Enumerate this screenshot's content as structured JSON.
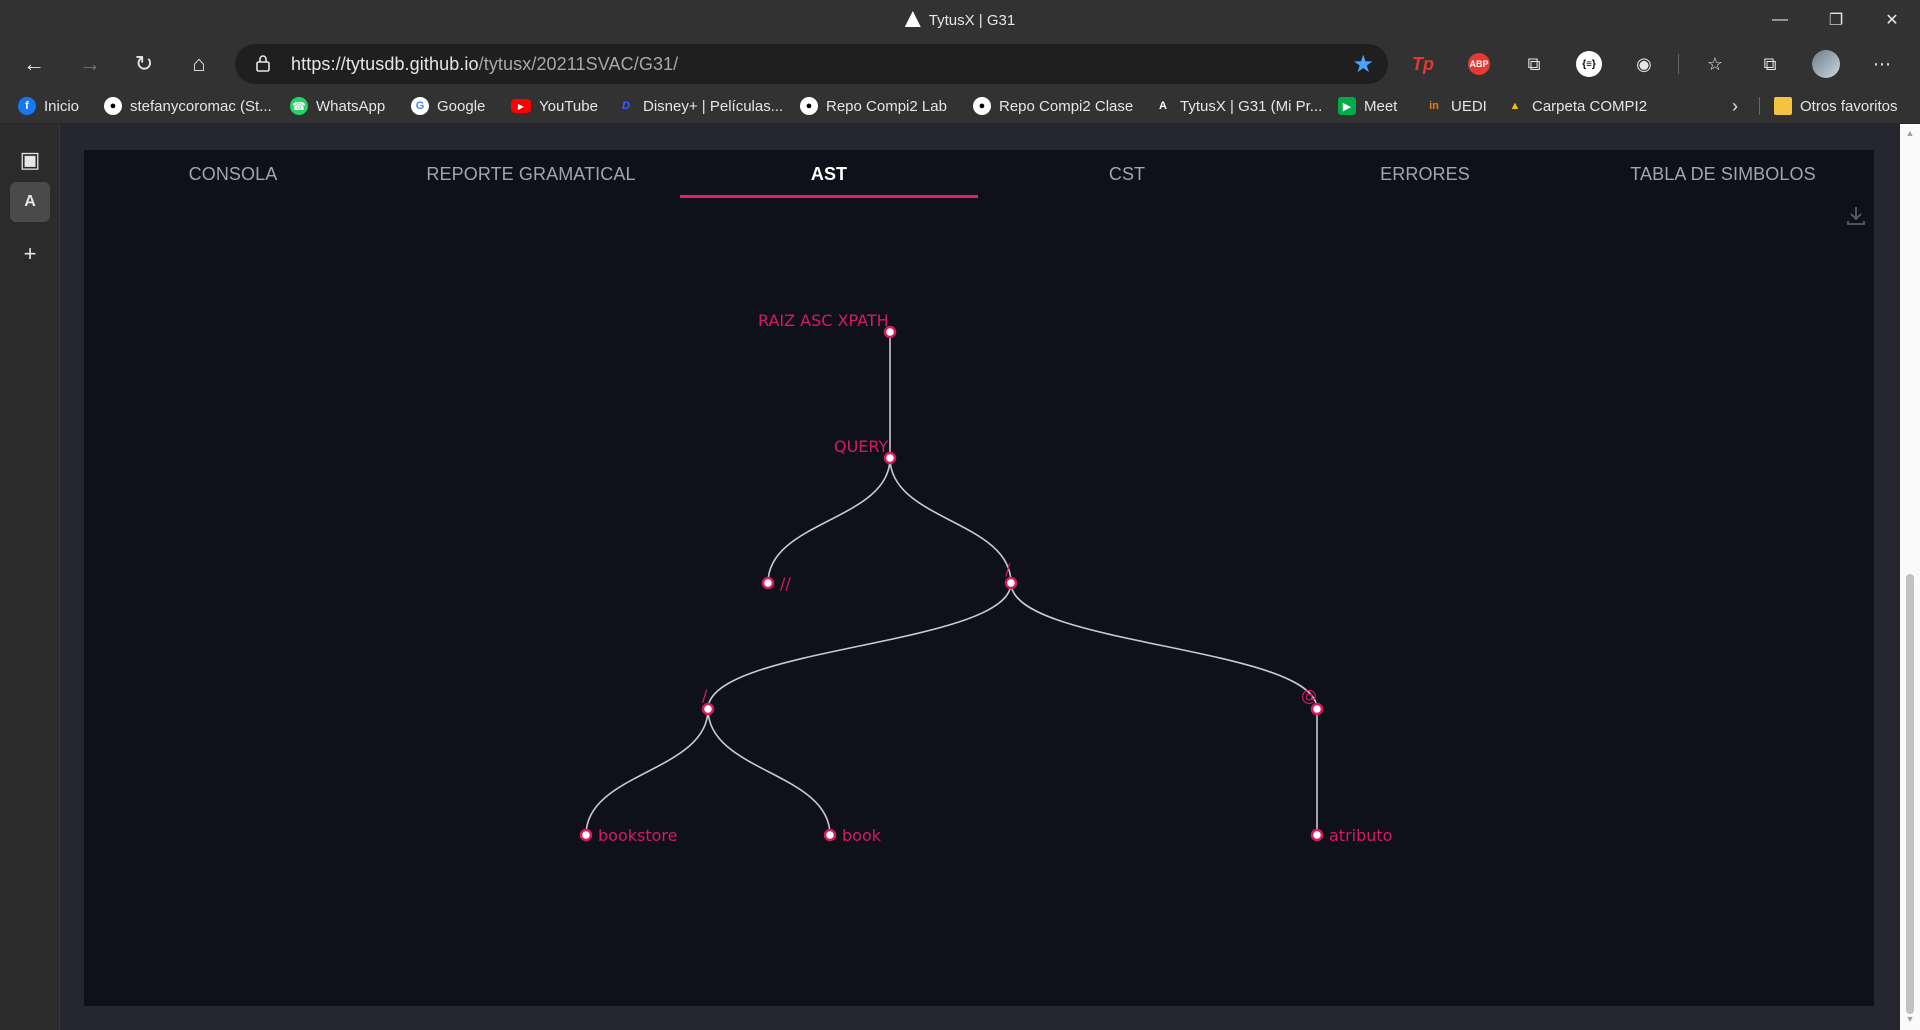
{
  "window": {
    "title": "TytusX | G31"
  },
  "address_bar": {
    "url_host": "https://tytusdb.github.io",
    "url_path": "/tytusx/20211SVAC/G31/"
  },
  "extensions": [
    "Tp",
    "ABP",
    "{≡}"
  ],
  "bookmarks": [
    {
      "label": "Inicio",
      "icon": "facebook-icon",
      "color": "#1877f2"
    },
    {
      "label": "stefanycoromac (St...",
      "icon": "github-icon",
      "color": "#ffffff"
    },
    {
      "label": "WhatsApp",
      "icon": "whatsapp-icon",
      "color": "#25d366"
    },
    {
      "label": "Google",
      "icon": "google-icon",
      "color": "#ffffff"
    },
    {
      "label": "YouTube",
      "icon": "youtube-icon",
      "color": "#ff0000"
    },
    {
      "label": "Disney+ | Películas...",
      "icon": "disney-icon",
      "color": "#1a3fd6"
    },
    {
      "label": "Repo Compi2 Lab",
      "icon": "github-icon",
      "color": "#ffffff"
    },
    {
      "label": "Repo Compi2 Clase",
      "icon": "github-icon",
      "color": "#ffffff"
    },
    {
      "label": "TytusX | G31 (Mi Pr...",
      "icon": "angular-icon",
      "color": "#ffffff"
    },
    {
      "label": "Meet",
      "icon": "meet-icon",
      "color": "#00ac47"
    },
    {
      "label": "UEDI",
      "icon": "uedi-icon",
      "color": "#f57c00"
    },
    {
      "label": "Carpeta COMPI2",
      "icon": "drive-icon",
      "color": "#fbbc04"
    }
  ],
  "other_favorites": "Otros favoritos",
  "tabs": [
    {
      "label": "CONSOLA"
    },
    {
      "label": "REPORTE GRAMATICAL"
    },
    {
      "label": "AST",
      "active": true
    },
    {
      "label": "CST"
    },
    {
      "label": "ERRORES"
    },
    {
      "label": "TABLA DE SIMBOLOS"
    }
  ],
  "tree": {
    "nodes": [
      {
        "id": "root",
        "label": "RAIZ ASC XPATH"
      },
      {
        "id": "query",
        "label": "QUERY",
        "parent": "root"
      },
      {
        "id": "dslash",
        "label": "//",
        "parent": "query"
      },
      {
        "id": "slash1",
        "label": "/",
        "parent": "query"
      },
      {
        "id": "slash2",
        "label": "/",
        "parent": "slash1"
      },
      {
        "id": "at",
        "label": "@",
        "parent": "slash1"
      },
      {
        "id": "bookstore",
        "label": "bookstore",
        "parent": "slash2"
      },
      {
        "id": "book",
        "label": "book",
        "parent": "slash2"
      },
      {
        "id": "atributo",
        "label": "atributo",
        "parent": "at"
      }
    ]
  }
}
